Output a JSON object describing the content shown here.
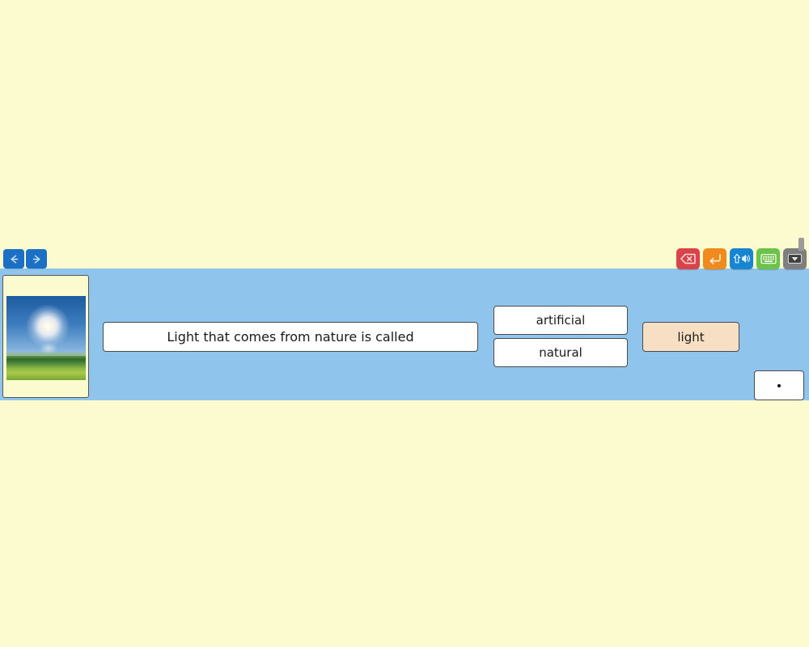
{
  "colors": {
    "page_background": "#fbfbcf",
    "panel_background": "#8fc4ec",
    "tile_background": "#ffffff",
    "word_tile_background": "#f7dfc3",
    "nav_button": "#1b6fc4",
    "tool_delete": "#d9434a",
    "tool_enter": "#f08a1c",
    "tool_shift": "#1785d0",
    "tool_keyboard": "#6cc24a",
    "tool_hide": "#7e7e7e"
  },
  "navigation": {
    "back": {
      "label": "←",
      "icon": "arrow-left-icon"
    },
    "forward": {
      "label": "→",
      "icon": "arrow-right-icon"
    }
  },
  "toolbar": {
    "buttons": [
      {
        "name": "delete",
        "icon": "backspace-icon",
        "color": "#d9434a"
      },
      {
        "name": "enter",
        "icon": "enter-return-icon",
        "color": "#f08a1c"
      },
      {
        "name": "shift-speak",
        "icon": "shift-speaker-icon",
        "color": "#1785d0"
      },
      {
        "name": "keyboard",
        "icon": "keyboard-icon",
        "color": "#6cc24a"
      },
      {
        "name": "hide-keyboard",
        "icon": "hide-keyboard-icon",
        "color": "#7e7e7e"
      }
    ]
  },
  "activity": {
    "picture": {
      "alt": "sun shining over a green field",
      "icon": "sun-over-field-photo"
    },
    "sentence": "Light that comes from nature is called",
    "options": [
      "artificial",
      "natural"
    ],
    "word_bank": [
      "light"
    ],
    "punctuation": "."
  }
}
